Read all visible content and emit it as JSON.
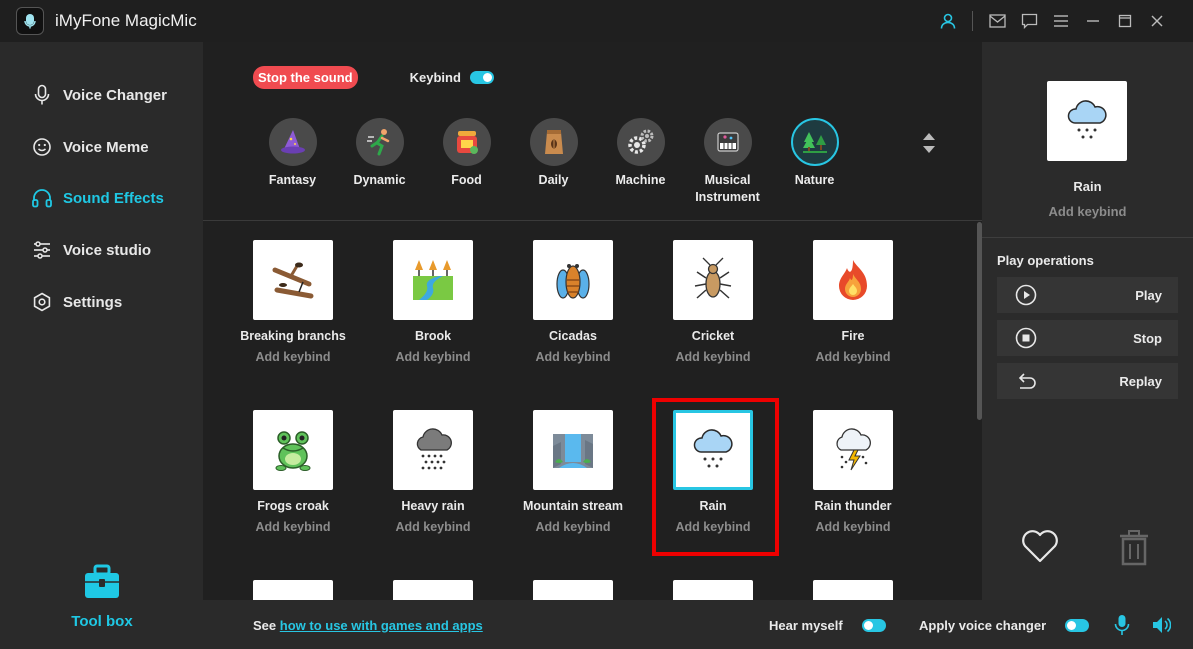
{
  "app": {
    "title": "iMyFone MagicMic"
  },
  "titlebar": {
    "icons": [
      "user-icon",
      "mail-icon",
      "feedback-icon",
      "menu-icon",
      "minimize-icon",
      "maximize-icon",
      "close-icon"
    ]
  },
  "sidebar": {
    "items": [
      {
        "label": "Voice Changer",
        "icon": "microphone-icon",
        "active": false
      },
      {
        "label": "Voice Meme",
        "icon": "smiley-icon",
        "active": false
      },
      {
        "label": "Sound Effects",
        "icon": "headphones-icon",
        "active": true
      },
      {
        "label": "Voice studio",
        "icon": "sliders-icon",
        "active": false
      },
      {
        "label": "Settings",
        "icon": "gear-icon",
        "active": false
      }
    ],
    "toolbox_label": "Tool box"
  },
  "controls": {
    "stop_label": "Stop the sound",
    "keybind_label": "Keybind",
    "keybind_on": true
  },
  "categories": [
    {
      "label": "Fantasy",
      "icon": "wizard-hat-icon"
    },
    {
      "label": "Dynamic",
      "icon": "runner-icon"
    },
    {
      "label": "Food",
      "icon": "food-icon"
    },
    {
      "label": "Daily",
      "icon": "coffee-bag-icon"
    },
    {
      "label": "Machine",
      "icon": "gears-icon"
    },
    {
      "label": "Musical Instrument",
      "icon": "piano-icon"
    },
    {
      "label": "Nature",
      "icon": "forest-icon",
      "active": true
    }
  ],
  "sounds": [
    {
      "name": "Breaking branchs",
      "keybind": "Add keybind",
      "icon": "branch-icon"
    },
    {
      "name": "Brook",
      "keybind": "Add keybind",
      "icon": "brook-icon"
    },
    {
      "name": "Cicadas",
      "keybind": "Add keybind",
      "icon": "cicada-icon"
    },
    {
      "name": "Cricket",
      "keybind": "Add keybind",
      "icon": "cricket-icon"
    },
    {
      "name": "Fire",
      "keybind": "Add keybind",
      "icon": "fire-icon"
    },
    {
      "name": "Frogs croak",
      "keybind": "Add keybind",
      "icon": "frog-icon"
    },
    {
      "name": "Heavy rain",
      "keybind": "Add keybind",
      "icon": "heavy-rain-icon"
    },
    {
      "name": "Mountain stream",
      "keybind": "Add keybind",
      "icon": "waterfall-icon"
    },
    {
      "name": "Rain",
      "keybind": "Add keybind",
      "icon": "rain-icon",
      "selected": true
    },
    {
      "name": "Rain thunder",
      "keybind": "Add keybind",
      "icon": "thunder-icon"
    }
  ],
  "preview": {
    "name": "Rain",
    "keybind": "Add keybind"
  },
  "play_ops": {
    "title": "Play operations",
    "play": "Play",
    "stop": "Stop",
    "replay": "Replay"
  },
  "bottombar": {
    "see_prefix": "See",
    "see_link": "how to use with games and apps",
    "hear_myself": "Hear myself",
    "apply_voice_changer": "Apply voice changer"
  },
  "colors": {
    "accent": "#28c6e3",
    "stop": "#f04b50",
    "highlight": "#e00000"
  }
}
